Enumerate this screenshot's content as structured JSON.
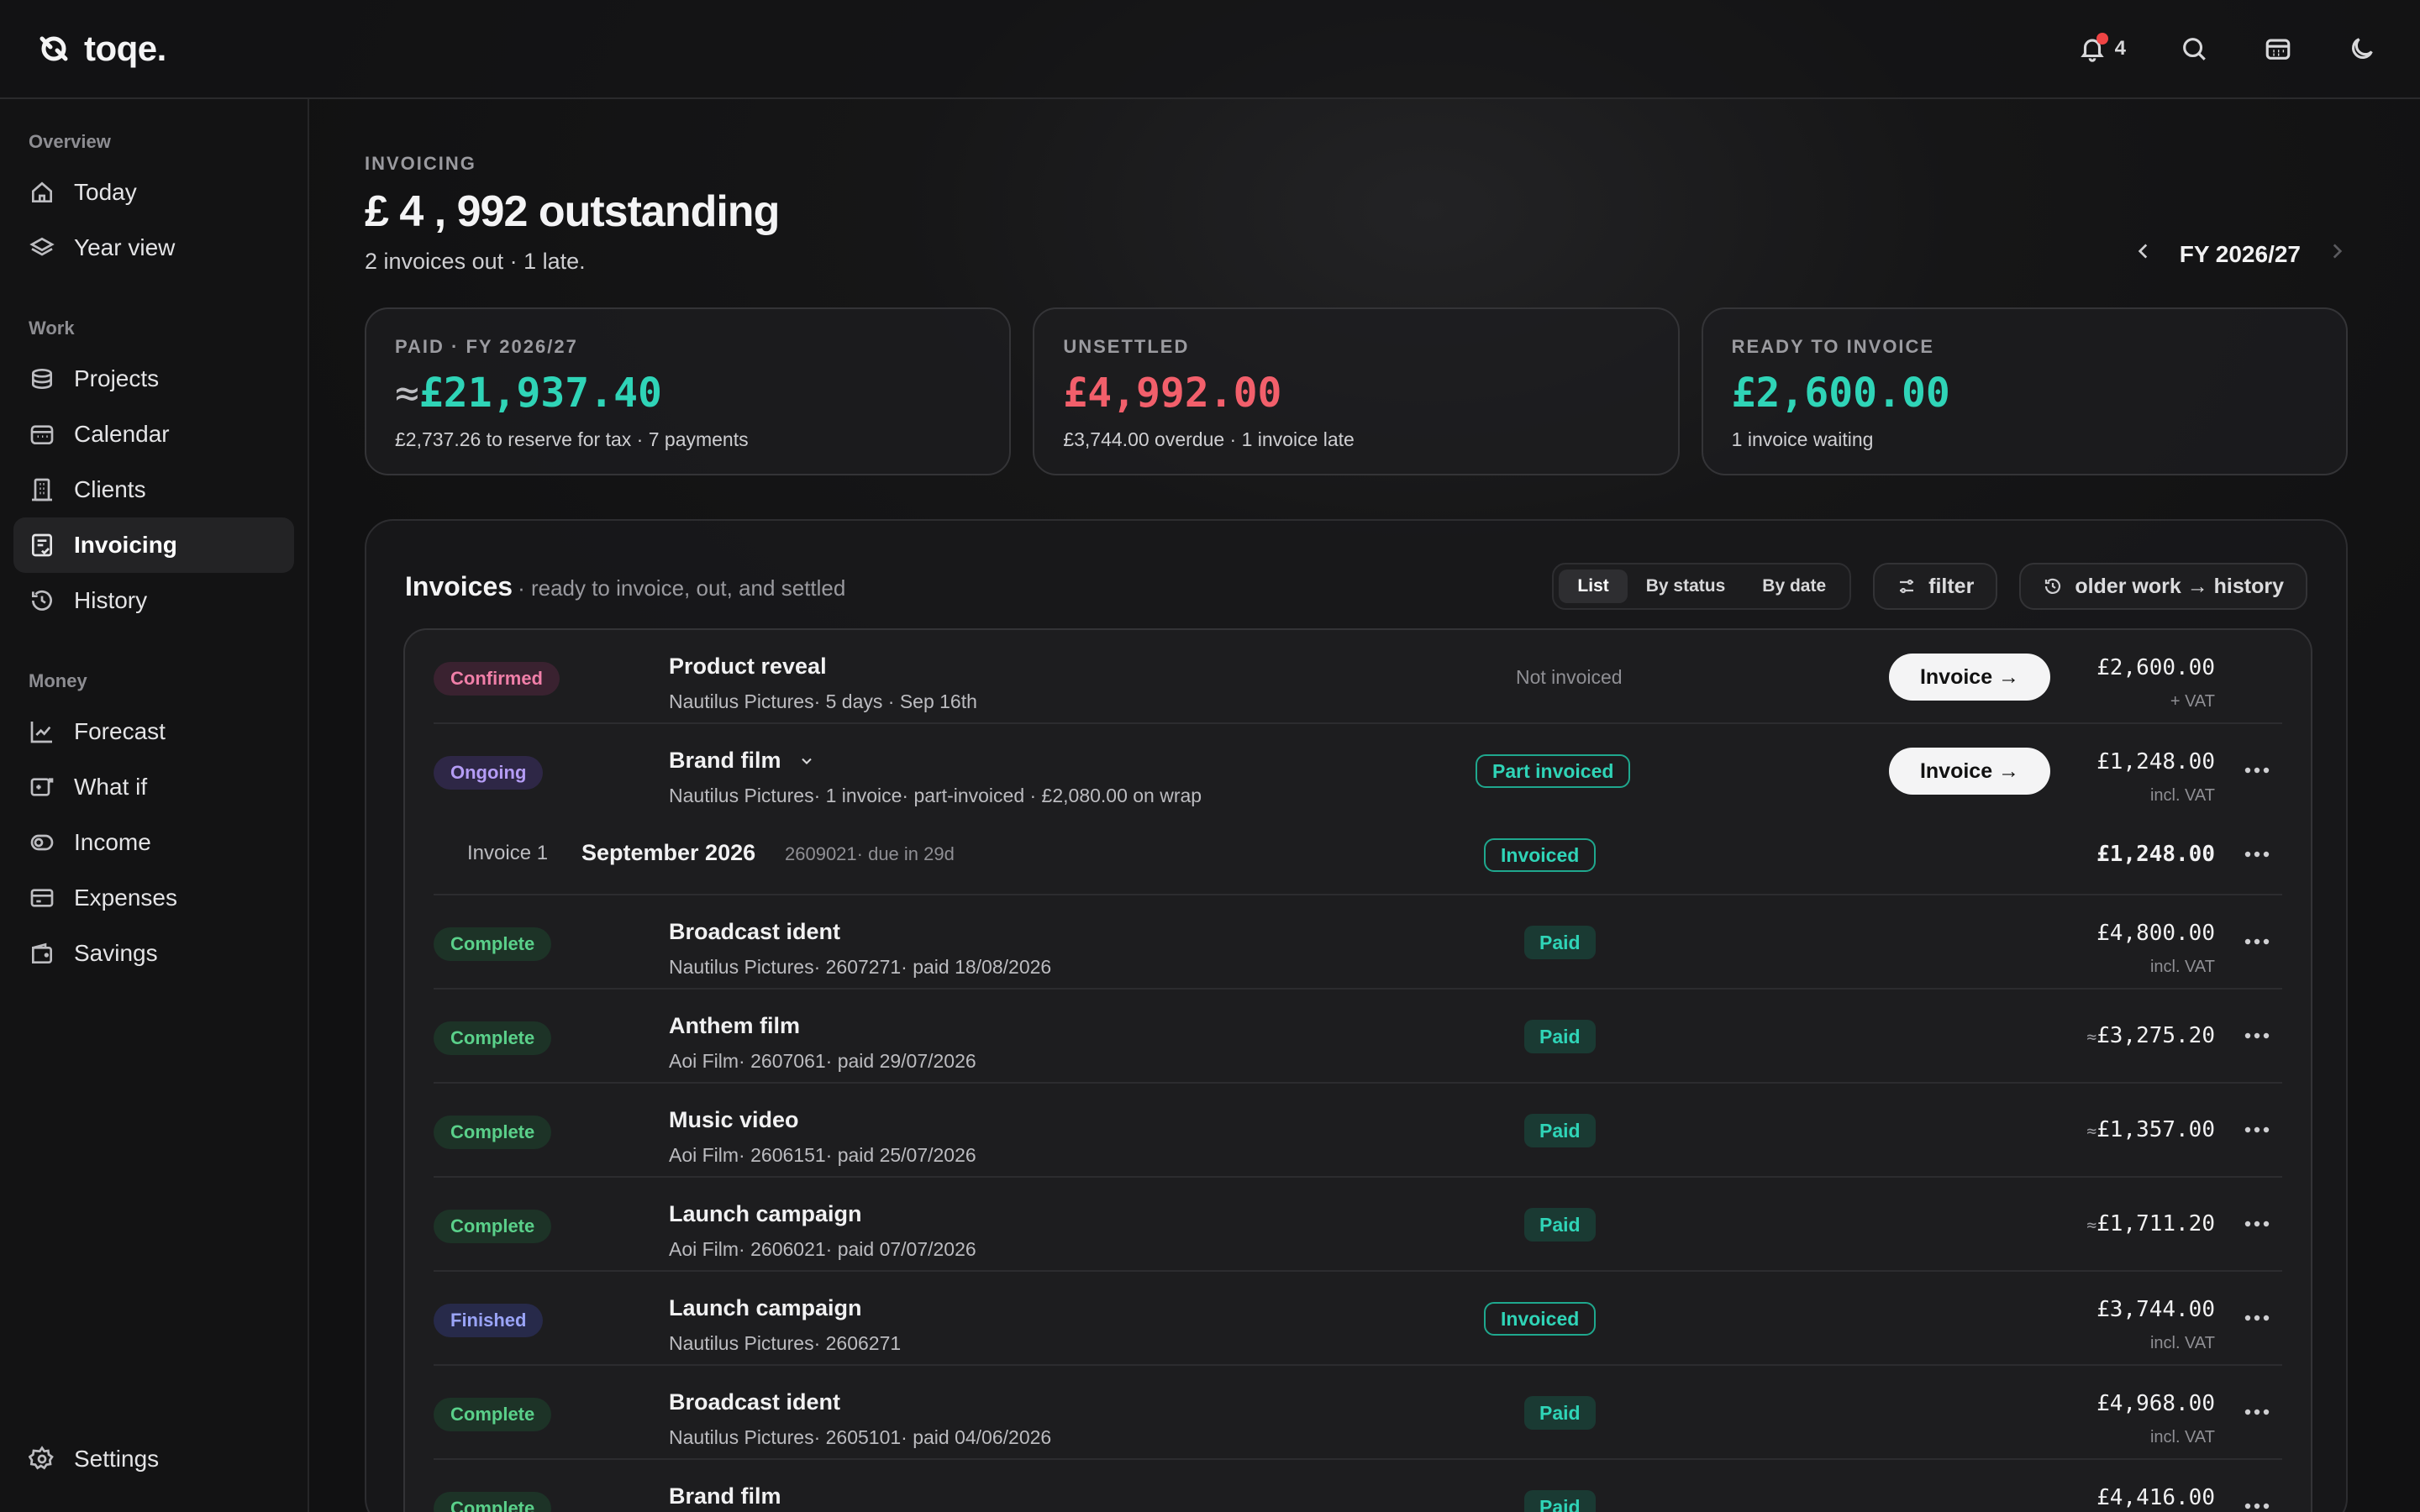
{
  "app": {
    "name": "toqe."
  },
  "topbar": {
    "notification_count": "4"
  },
  "sidebar": {
    "sections": [
      {
        "label": "Overview",
        "items": [
          {
            "label": "Today",
            "icon": "home-icon"
          },
          {
            "label": "Year view",
            "icon": "layers-icon"
          }
        ]
      },
      {
        "label": "Work",
        "items": [
          {
            "label": "Projects",
            "icon": "stack-icon"
          },
          {
            "label": "Calendar",
            "icon": "calendar-icon"
          },
          {
            "label": "Clients",
            "icon": "building-icon"
          },
          {
            "label": "Invoicing",
            "icon": "invoice-icon",
            "active": true
          },
          {
            "label": "History",
            "icon": "history-icon"
          }
        ]
      },
      {
        "label": "Money",
        "items": [
          {
            "label": "Forecast",
            "icon": "trend-icon"
          },
          {
            "label": "What if",
            "icon": "sliders-icon"
          },
          {
            "label": "Income",
            "icon": "coins-icon"
          },
          {
            "label": "Expenses",
            "icon": "card-icon"
          },
          {
            "label": "Savings",
            "icon": "wallet-icon"
          }
        ]
      }
    ],
    "settings_label": "Settings"
  },
  "header": {
    "eyebrow": "INVOICING",
    "title": "£ 4 , 992 outstanding",
    "subtitle": "2 invoices out · 1 late.",
    "fy_label": "FY 2026/27"
  },
  "cards": [
    {
      "label": "PAID · FY 2026/27",
      "approx": "≈",
      "amount": "£21,937.40",
      "note": "£2,737.26 to reserve for tax · 7 payments",
      "color": "#2fd4b7"
    },
    {
      "label": "UNSETTLED",
      "approx": "",
      "amount": "£4,992.00",
      "note": "£3,744.00 overdue · 1 invoice late",
      "color": "#f25f6b"
    },
    {
      "label": "READY TO INVOICE",
      "approx": "",
      "amount": "£2,600.00",
      "note": "1 invoice waiting",
      "color": "#2fd4b7"
    }
  ],
  "panel": {
    "title": "Invoices",
    "subtitle": "· ready to invoice, out, and settled",
    "views": [
      "List",
      "By status",
      "By date"
    ],
    "filter_label": "filter",
    "history_label": "older work → history"
  },
  "invoices": [
    {
      "badge": "Confirmed",
      "title": "Product reveal",
      "meta": "Nautilus Pictures· 5 days · Sep 16th",
      "status": "Not invoiced",
      "action": "Invoice →",
      "approx": "",
      "amount": "£2,600.00",
      "vat": "+ VAT"
    },
    {
      "badge": "Ongoing",
      "title": "Brand film",
      "meta": "Nautilus Pictures· 1 invoice· part-invoiced · £2,080.00 on wrap",
      "status": "Part invoiced",
      "action": "Invoice →",
      "approx": "",
      "amount": "£1,248.00",
      "vat": "incl. VAT"
    },
    {
      "sub": true,
      "label": "Invoice 1",
      "title": "September 2026",
      "meta": "2609021· due in 29d",
      "status": "Invoiced",
      "amount": "£1,248.00"
    },
    {
      "badge": "Complete",
      "title": "Broadcast ident",
      "meta": "Nautilus Pictures· 2607271· paid 18/08/2026",
      "status": "Paid",
      "approx": "",
      "amount": "£4,800.00",
      "vat": "incl. VAT"
    },
    {
      "badge": "Complete",
      "title": "Anthem film",
      "meta": "Aoi Film· 2607061· paid 29/07/2026",
      "status": "Paid",
      "approx": "≈",
      "amount": "£3,275.20",
      "vat": ""
    },
    {
      "badge": "Complete",
      "title": "Music video",
      "meta": "Aoi Film· 2606151· paid 25/07/2026",
      "status": "Paid",
      "approx": "≈",
      "amount": "£1,357.00",
      "vat": ""
    },
    {
      "badge": "Complete",
      "title": "Launch campaign",
      "meta": "Aoi Film· 2606021· paid 07/07/2026",
      "status": "Paid",
      "approx": "≈",
      "amount": "£1,711.20",
      "vat": ""
    },
    {
      "badge": "Finished",
      "title": "Launch campaign",
      "meta": "Nautilus Pictures· 2606271",
      "status": "Invoiced",
      "approx": "",
      "amount": "£3,744.00",
      "vat": "incl. VAT"
    },
    {
      "badge": "Complete",
      "title": "Broadcast ident",
      "meta": "Nautilus Pictures· 2605101· paid 04/06/2026",
      "status": "Paid",
      "approx": "",
      "amount": "£4,968.00",
      "vat": "incl. VAT"
    },
    {
      "badge": "Complete",
      "title": "Brand film",
      "meta": "",
      "status": "Paid",
      "approx": "",
      "amount": "£4,416.00",
      "vat": ""
    }
  ]
}
